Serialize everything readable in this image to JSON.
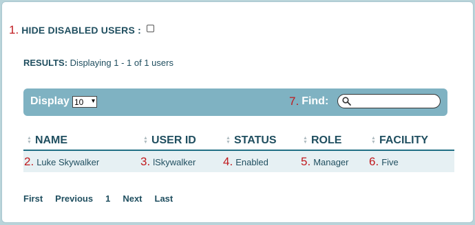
{
  "filters": {
    "hide_disabled_label": "HIDE DISABLED USERS :",
    "hide_disabled_checked": false,
    "annotation": "1."
  },
  "results": {
    "label": "RESULTS:",
    "text": "Displaying 1 - 1 of 1 users"
  },
  "toolbar": {
    "display_label": "Display",
    "page_size": "10",
    "find_label": "Find:",
    "find_annotation": "7.",
    "search_value": "",
    "search_icon": "search-icon"
  },
  "table": {
    "columns": [
      "NAME",
      "USER ID",
      "STATUS",
      "ROLE",
      "FACILITY"
    ],
    "rows": [
      {
        "name": "Luke Skywalker",
        "user_id": "lSkywalker",
        "status": "Enabled",
        "role": "Manager",
        "facility": "Five",
        "annotations": [
          "2.",
          "3.",
          "4.",
          "5.",
          "6."
        ]
      }
    ]
  },
  "pagination": {
    "first": "First",
    "previous": "Previous",
    "current": "1",
    "next": "Next",
    "last": "Last"
  },
  "colors": {
    "accent": "#7fb2c2",
    "text": "#1f4e5f",
    "annotation": "#c0191d",
    "row_bg": "#e6f0f3"
  }
}
